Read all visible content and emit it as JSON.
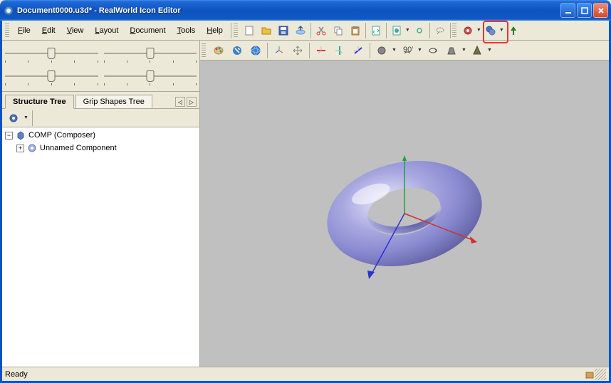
{
  "title": "Document0000.u3d* - RealWorld Icon Editor",
  "menu": {
    "file": "File",
    "edit": "Edit",
    "view": "View",
    "layout": "Layout",
    "document": "Document",
    "tools": "Tools",
    "help": "Help"
  },
  "tabs": {
    "structure": "Structure Tree",
    "grip": "Grip Shapes Tree"
  },
  "tree": {
    "root": "COMP (Composer)",
    "child": "Unnamed Component"
  },
  "status": "Ready",
  "icons": {
    "new": "new",
    "open": "open",
    "save": "save",
    "export": "export",
    "cut": "cut",
    "copy": "copy",
    "paste": "paste",
    "doc1": "doc1",
    "doc2": "doc2",
    "link": "link",
    "gear1": "gear1",
    "gear2": "gear2",
    "tree": "tree",
    "palette": "palette",
    "wrench": "wrench",
    "globe": "globe",
    "axis1": "axis1",
    "axis2": "axis2",
    "axis3": "axis3",
    "axis4": "axis4",
    "axis5": "axis5",
    "obj": "obj",
    "rotate": "rotate",
    "rotate2": "rotate2",
    "cone": "cone",
    "pyramid": "pyramid"
  }
}
